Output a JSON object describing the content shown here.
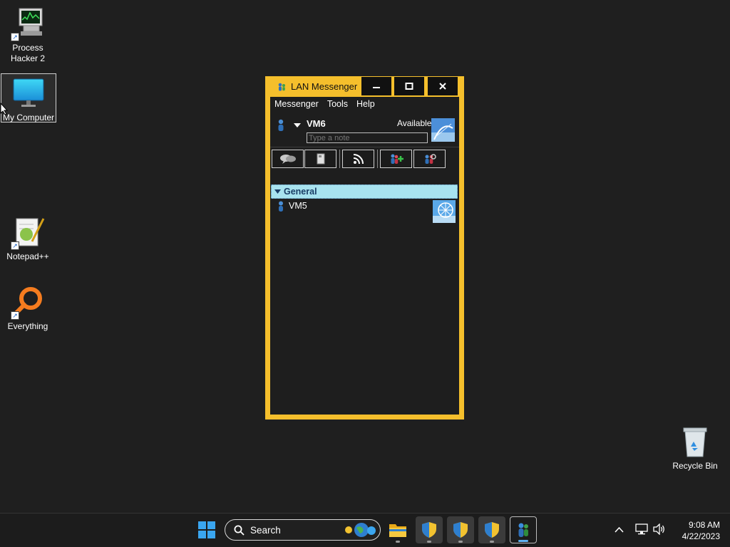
{
  "desktop": {
    "icons": [
      {
        "label_line1": "Process",
        "label_line2": "Hacker 2",
        "icon": "process-hacker-icon"
      },
      {
        "label": "My Computer",
        "icon": "monitor-icon"
      },
      {
        "label": "Notepad++",
        "icon": "notepad-plus-plus-icon"
      },
      {
        "label": "Everything",
        "icon": "magnifier-icon"
      },
      {
        "label": "Recycle Bin",
        "icon": "recycle-bin-icon"
      }
    ]
  },
  "window": {
    "title": "LAN Messenger",
    "menu": [
      "Messenger",
      "Tools",
      "Help"
    ],
    "profile": {
      "name": "VM6",
      "status": "Available",
      "note_placeholder": "Type a note"
    },
    "toolbar_icons": [
      "chat-icon",
      "file-transfer-icon",
      "broadcast-icon",
      "add-contact-icon",
      "refresh-contacts-icon"
    ],
    "group": {
      "name": "General"
    },
    "contacts": [
      {
        "name": "VM5"
      }
    ],
    "colors": {
      "frame": "#f5bf2c",
      "group_header": "#a8e3ef"
    }
  },
  "taskbar": {
    "search_label": "Search",
    "clock_time": "9:08 AM",
    "clock_date": "4/22/2023"
  }
}
